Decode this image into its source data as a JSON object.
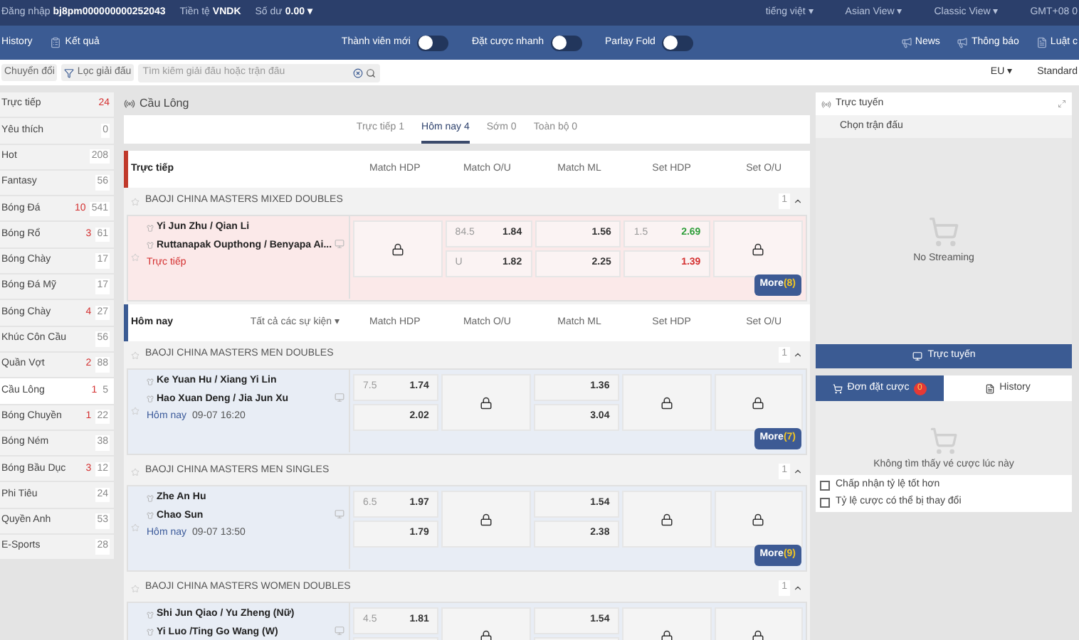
{
  "top_bar": {
    "login_label": "Đăng nhập",
    "username": "bj8pm000000000252043",
    "currency_label": "Tiền tệ",
    "currency": "VNDK",
    "balance_label": "Số dư",
    "balance": "0.00 ▾",
    "menus": [
      "tiếng việt ▾",
      "Asian View ▾",
      "Classic View ▾",
      "GMT+08 0"
    ]
  },
  "nav_bar": {
    "history": "History",
    "results": "Kết quả",
    "toggles": [
      {
        "label": "Thành viên mới",
        "on": false
      },
      {
        "label": "Đặt cược nhanh",
        "on": false
      },
      {
        "label": "Parlay Fold",
        "on": false
      }
    ],
    "links": [
      {
        "kind": "news",
        "label": "News"
      },
      {
        "kind": "notice",
        "label": "Thông báo"
      },
      {
        "kind": "rules",
        "label": "Luật c"
      }
    ]
  },
  "filter_bar": {
    "switch": "Chuyển đổi",
    "league_filter": "Lọc giải đấu",
    "search": {
      "placeholder": "Tìm kiếm giải đấu hoặc trận đấu"
    },
    "odds_format": "EU ▾",
    "view": "Standard"
  },
  "sidebar": {
    "items": [
      {
        "label": "Trực tiếp",
        "live": "24",
        "selected": false
      },
      {
        "label": "Yêu thích",
        "total": "0",
        "selected": false
      },
      {
        "label": "Hot",
        "total": "208",
        "selected": false
      },
      {
        "label": "Fantasy",
        "total": "56",
        "selected": false
      },
      {
        "label": "Bóng Đá",
        "live": "10",
        "total": "541",
        "selected": false
      },
      {
        "label": "Bóng Rổ",
        "live": "3",
        "total": "61",
        "selected": false
      },
      {
        "label": "Bóng Chày",
        "total": "17",
        "selected": false
      },
      {
        "label": "Bóng Đá Mỹ",
        "total": "17",
        "selected": false
      },
      {
        "label": "Bóng Chày",
        "live": "4",
        "total": "27",
        "selected": false
      },
      {
        "label": "Khúc Côn Cầu",
        "total": "56",
        "selected": false
      },
      {
        "label": "Quần Vợt",
        "live": "2",
        "total": "88",
        "selected": false
      },
      {
        "label": "Cầu Lông",
        "live": "1",
        "total": "5",
        "selected": true
      },
      {
        "label": "Bóng Chuyền",
        "live": "1",
        "total": "22",
        "selected": false
      },
      {
        "label": "Bóng Ném",
        "total": "38",
        "selected": false
      },
      {
        "label": "Bóng Bầu Dục",
        "live": "3",
        "total": "12",
        "selected": false
      },
      {
        "label": "Phi Tiêu",
        "total": "24",
        "selected": false
      },
      {
        "label": "Quyền Anh",
        "total": "53",
        "selected": false
      },
      {
        "label": "E-Sports",
        "total": "28",
        "selected": false
      }
    ]
  },
  "main": {
    "sport": "Cầu Lông",
    "tabs": [
      {
        "label": "Trực tiếp 1",
        "selected": false
      },
      {
        "label": "Hôm nay 4",
        "selected": true
      },
      {
        "label": "Sớm 0",
        "selected": false
      },
      {
        "label": "Toàn bộ 0",
        "selected": false
      }
    ],
    "sections": [
      {
        "kind": "live",
        "title": "Trực tiếp",
        "columns": [
          "Match HDP",
          "Match O/U",
          "Match ML",
          "Set HDP",
          "Set O/U"
        ],
        "leagues": [
          {
            "name": "BAOJI CHINA MASTERS MIXED DOUBLES",
            "count": "1",
            "matches": [
              {
                "kind": "live",
                "teams": [
                  "Yi Jun Zhu / Qian Li",
                  "Ruttanapak Oupthong / Benyapa Ai..."
                ],
                "status": "Trực tiếp",
                "more": "More",
                "more_count": "(8)",
                "odds": [
                  {
                    "kind": "locked"
                  },
                  {
                    "kind": "pair",
                    "rows": [
                      {
                        "line": "84.5",
                        "price": "1.84"
                      },
                      {
                        "line": "U",
                        "price": "1.82"
                      }
                    ]
                  },
                  {
                    "kind": "pair",
                    "rows": [
                      {
                        "price": "1.56"
                      },
                      {
                        "price": "2.25"
                      }
                    ]
                  },
                  {
                    "kind": "pair",
                    "rows": [
                      {
                        "line": "1.5",
                        "price": "2.69",
                        "color": "#2e9e3a"
                      },
                      {
                        "price": "1.39",
                        "color": "#d43030"
                      }
                    ]
                  },
                  {
                    "kind": "locked"
                  }
                ]
              }
            ]
          }
        ]
      },
      {
        "kind": "today",
        "title": "Hôm nay",
        "filter": "Tất cả các sự kiện ▾",
        "columns": [
          "Match HDP",
          "Match O/U",
          "Match ML",
          "Set HDP",
          "Set O/U"
        ],
        "leagues": [
          {
            "name": "BAOJI CHINA MASTERS MEN DOUBLES",
            "count": "1",
            "matches": [
              {
                "kind": "today",
                "teams": [
                  "Ke Yuan Hu / Xiang Yi Lin",
                  "Hao Xuan Deng / Jia Jun Xu"
                ],
                "status": "Hôm nay",
                "time": "09-07 16:20",
                "more": "More",
                "more_count": "(7)",
                "odds": [
                  {
                    "kind": "pair",
                    "rows": [
                      {
                        "line": "7.5",
                        "price": "1.74"
                      },
                      {
                        "price": "2.02"
                      }
                    ]
                  },
                  {
                    "kind": "locked"
                  },
                  {
                    "kind": "pair",
                    "rows": [
                      {
                        "price": "1.36"
                      },
                      {
                        "price": "3.04"
                      }
                    ]
                  },
                  {
                    "kind": "locked"
                  },
                  {
                    "kind": "locked"
                  }
                ]
              }
            ]
          },
          {
            "name": "BAOJI CHINA MASTERS MEN SINGLES",
            "count": "1",
            "matches": [
              {
                "kind": "today",
                "teams": [
                  "Zhe An Hu",
                  "Chao Sun"
                ],
                "status": "Hôm nay",
                "time": "09-07 13:50",
                "more": "More",
                "more_count": "(9)",
                "odds": [
                  {
                    "kind": "pair",
                    "rows": [
                      {
                        "line": "6.5",
                        "price": "1.97"
                      },
                      {
                        "price": "1.79"
                      }
                    ]
                  },
                  {
                    "kind": "locked"
                  },
                  {
                    "kind": "pair",
                    "rows": [
                      {
                        "price": "1.54"
                      },
                      {
                        "price": "2.38"
                      }
                    ]
                  },
                  {
                    "kind": "locked"
                  },
                  {
                    "kind": "locked"
                  }
                ]
              }
            ]
          },
          {
            "name": "BAOJI CHINA MASTERS WOMEN DOUBLES",
            "count": "1",
            "matches": [
              {
                "kind": "today",
                "teams": [
                  "Shi Jun Qiao / Yu Zheng (Nữ)",
                  "Yi Luo /Ting Go Wang (W)"
                ],
                "odds": [
                  {
                    "kind": "pair",
                    "rows": [
                      {
                        "line": "4.5",
                        "price": "1.81"
                      },
                      {}
                    ]
                  },
                  {
                    "kind": "locked"
                  },
                  {
                    "kind": "pair",
                    "rows": [
                      {
                        "price": "1.54"
                      },
                      {}
                    ]
                  },
                  {
                    "kind": "locked"
                  },
                  {
                    "kind": "locked"
                  }
                ]
              }
            ]
          }
        ]
      }
    ]
  },
  "right_panel": {
    "title": "Trực tuyến",
    "match_select": "Chọn trận đấu",
    "empty_stream": "No Streaming",
    "stream_button": "Trực tuyến",
    "tabs": [
      {
        "kind": "slip",
        "label": "Đơn đặt cược",
        "badge": "0",
        "selected": true
      },
      {
        "kind": "history",
        "label": "History",
        "selected": false
      }
    ],
    "empty_slip": "Không tìm thấy vé cược lúc này",
    "options": [
      {
        "label": "Chấp nhận tỷ lệ tốt hơn",
        "checked": false
      },
      {
        "label": "Tỷ lệ cược có thể bị thay đổi",
        "checked": false
      }
    ]
  }
}
